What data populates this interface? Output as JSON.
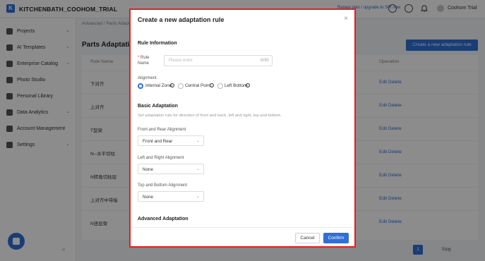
{
  "app": {
    "logo": "K",
    "title": "KITCHENBATH_COOHOM_TRIAL",
    "promo": "Renew plan / upgrade to SPI now",
    "user_name": "Coohom Trial"
  },
  "topbar_icons": [
    "globe-icon",
    "help-icon",
    "bell-icon"
  ],
  "sidebar": {
    "items": [
      {
        "label": "Projects",
        "icon": "folder-icon",
        "chevron": "⌄"
      },
      {
        "label": "AI Templates",
        "icon": "sparkle-icon",
        "chevron": "⌄"
      },
      {
        "label": "Enterprise Catalog",
        "icon": "catalog-icon",
        "chevron": "⌄"
      },
      {
        "label": "Photo Studio",
        "icon": "camera-icon",
        "chevron": ""
      },
      {
        "label": "Personal Library",
        "icon": "library-icon",
        "chevron": ""
      },
      {
        "label": "Data Analytics",
        "icon": "chart-icon",
        "chevron": "⌄"
      },
      {
        "label": "Account Management",
        "icon": "user-icon",
        "chevron": ""
      },
      {
        "label": "Settings",
        "icon": "gear-icon",
        "chevron": "⌄"
      }
    ],
    "collapse": "«"
  },
  "main": {
    "breadcrumb": "Advanced  /  Parts Adaptation",
    "title": "Parts Adaptation",
    "create_button": "Create a new adaptation rule",
    "columns": {
      "name": "Rule Name",
      "operation": "Operation"
    },
    "rows": [
      {
        "name": "下对齐",
        "edit": "Edit",
        "delete": "Delete"
      },
      {
        "name": "上对齐",
        "edit": "Edit",
        "delete": "Delete"
      },
      {
        "name": "T型架",
        "edit": "Edit",
        "delete": "Delete"
      },
      {
        "name": "N--水平切柱",
        "edit": "Edit",
        "delete": "Delete"
      },
      {
        "name": "N转角切柱层",
        "edit": "Edit",
        "delete": "Delete"
      },
      {
        "name": "上对齐中带板",
        "edit": "Edit",
        "delete": "Delete"
      },
      {
        "name": "N竖层架",
        "edit": "Edit",
        "delete": "Delete"
      }
    ],
    "pagination": {
      "page": "1",
      "page_size": "5/pg"
    }
  },
  "modal": {
    "title": "Create a new adaptation rule",
    "close": "×",
    "rule_info_title": "Rule Information",
    "rule_name_label": "Rule Name",
    "rule_name_placeholder": "Please enter",
    "rule_name_count": "0/30",
    "alignment_label": "Alignment",
    "alignment_options": [
      "Internal Zone",
      "Central Point",
      "Left Bottom"
    ],
    "alignment_selected": "Internal Zone",
    "basic_title": "Basic Adaptation",
    "basic_desc": "Set adaptation rule for direction of front and back, left and right, top and bottom.",
    "front_rear_label": "Front and Rear Alignment",
    "front_rear_value": "Front and Rear",
    "left_right_label": "Left and Right Alignment",
    "left_right_value": "None",
    "top_bottom_label": "Top and Bottom Alignment",
    "top_bottom_value": "None",
    "advanced_title": "Advanced Adaptation",
    "cancel": "Cancel",
    "confirm": "Confirm"
  },
  "colors": {
    "accent": "#2f6fd6",
    "highlight_border": "#e02020"
  }
}
